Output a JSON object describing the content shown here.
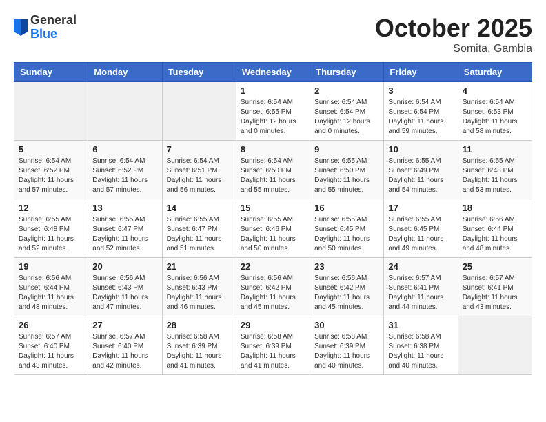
{
  "header": {
    "logo_general": "General",
    "logo_blue": "Blue",
    "month": "October 2025",
    "location": "Somita, Gambia"
  },
  "weekdays": [
    "Sunday",
    "Monday",
    "Tuesday",
    "Wednesday",
    "Thursday",
    "Friday",
    "Saturday"
  ],
  "weeks": [
    [
      {
        "day": "",
        "info": ""
      },
      {
        "day": "",
        "info": ""
      },
      {
        "day": "",
        "info": ""
      },
      {
        "day": "1",
        "info": "Sunrise: 6:54 AM\nSunset: 6:55 PM\nDaylight: 12 hours\nand 0 minutes."
      },
      {
        "day": "2",
        "info": "Sunrise: 6:54 AM\nSunset: 6:54 PM\nDaylight: 12 hours\nand 0 minutes."
      },
      {
        "day": "3",
        "info": "Sunrise: 6:54 AM\nSunset: 6:54 PM\nDaylight: 11 hours\nand 59 minutes."
      },
      {
        "day": "4",
        "info": "Sunrise: 6:54 AM\nSunset: 6:53 PM\nDaylight: 11 hours\nand 58 minutes."
      }
    ],
    [
      {
        "day": "5",
        "info": "Sunrise: 6:54 AM\nSunset: 6:52 PM\nDaylight: 11 hours\nand 57 minutes."
      },
      {
        "day": "6",
        "info": "Sunrise: 6:54 AM\nSunset: 6:52 PM\nDaylight: 11 hours\nand 57 minutes."
      },
      {
        "day": "7",
        "info": "Sunrise: 6:54 AM\nSunset: 6:51 PM\nDaylight: 11 hours\nand 56 minutes."
      },
      {
        "day": "8",
        "info": "Sunrise: 6:54 AM\nSunset: 6:50 PM\nDaylight: 11 hours\nand 55 minutes."
      },
      {
        "day": "9",
        "info": "Sunrise: 6:55 AM\nSunset: 6:50 PM\nDaylight: 11 hours\nand 55 minutes."
      },
      {
        "day": "10",
        "info": "Sunrise: 6:55 AM\nSunset: 6:49 PM\nDaylight: 11 hours\nand 54 minutes."
      },
      {
        "day": "11",
        "info": "Sunrise: 6:55 AM\nSunset: 6:48 PM\nDaylight: 11 hours\nand 53 minutes."
      }
    ],
    [
      {
        "day": "12",
        "info": "Sunrise: 6:55 AM\nSunset: 6:48 PM\nDaylight: 11 hours\nand 52 minutes."
      },
      {
        "day": "13",
        "info": "Sunrise: 6:55 AM\nSunset: 6:47 PM\nDaylight: 11 hours\nand 52 minutes."
      },
      {
        "day": "14",
        "info": "Sunrise: 6:55 AM\nSunset: 6:47 PM\nDaylight: 11 hours\nand 51 minutes."
      },
      {
        "day": "15",
        "info": "Sunrise: 6:55 AM\nSunset: 6:46 PM\nDaylight: 11 hours\nand 50 minutes."
      },
      {
        "day": "16",
        "info": "Sunrise: 6:55 AM\nSunset: 6:45 PM\nDaylight: 11 hours\nand 50 minutes."
      },
      {
        "day": "17",
        "info": "Sunrise: 6:55 AM\nSunset: 6:45 PM\nDaylight: 11 hours\nand 49 minutes."
      },
      {
        "day": "18",
        "info": "Sunrise: 6:56 AM\nSunset: 6:44 PM\nDaylight: 11 hours\nand 48 minutes."
      }
    ],
    [
      {
        "day": "19",
        "info": "Sunrise: 6:56 AM\nSunset: 6:44 PM\nDaylight: 11 hours\nand 48 minutes."
      },
      {
        "day": "20",
        "info": "Sunrise: 6:56 AM\nSunset: 6:43 PM\nDaylight: 11 hours\nand 47 minutes."
      },
      {
        "day": "21",
        "info": "Sunrise: 6:56 AM\nSunset: 6:43 PM\nDaylight: 11 hours\nand 46 minutes."
      },
      {
        "day": "22",
        "info": "Sunrise: 6:56 AM\nSunset: 6:42 PM\nDaylight: 11 hours\nand 45 minutes."
      },
      {
        "day": "23",
        "info": "Sunrise: 6:56 AM\nSunset: 6:42 PM\nDaylight: 11 hours\nand 45 minutes."
      },
      {
        "day": "24",
        "info": "Sunrise: 6:57 AM\nSunset: 6:41 PM\nDaylight: 11 hours\nand 44 minutes."
      },
      {
        "day": "25",
        "info": "Sunrise: 6:57 AM\nSunset: 6:41 PM\nDaylight: 11 hours\nand 43 minutes."
      }
    ],
    [
      {
        "day": "26",
        "info": "Sunrise: 6:57 AM\nSunset: 6:40 PM\nDaylight: 11 hours\nand 43 minutes."
      },
      {
        "day": "27",
        "info": "Sunrise: 6:57 AM\nSunset: 6:40 PM\nDaylight: 11 hours\nand 42 minutes."
      },
      {
        "day": "28",
        "info": "Sunrise: 6:58 AM\nSunset: 6:39 PM\nDaylight: 11 hours\nand 41 minutes."
      },
      {
        "day": "29",
        "info": "Sunrise: 6:58 AM\nSunset: 6:39 PM\nDaylight: 11 hours\nand 41 minutes."
      },
      {
        "day": "30",
        "info": "Sunrise: 6:58 AM\nSunset: 6:39 PM\nDaylight: 11 hours\nand 40 minutes."
      },
      {
        "day": "31",
        "info": "Sunrise: 6:58 AM\nSunset: 6:38 PM\nDaylight: 11 hours\nand 40 minutes."
      },
      {
        "day": "",
        "info": ""
      }
    ]
  ]
}
